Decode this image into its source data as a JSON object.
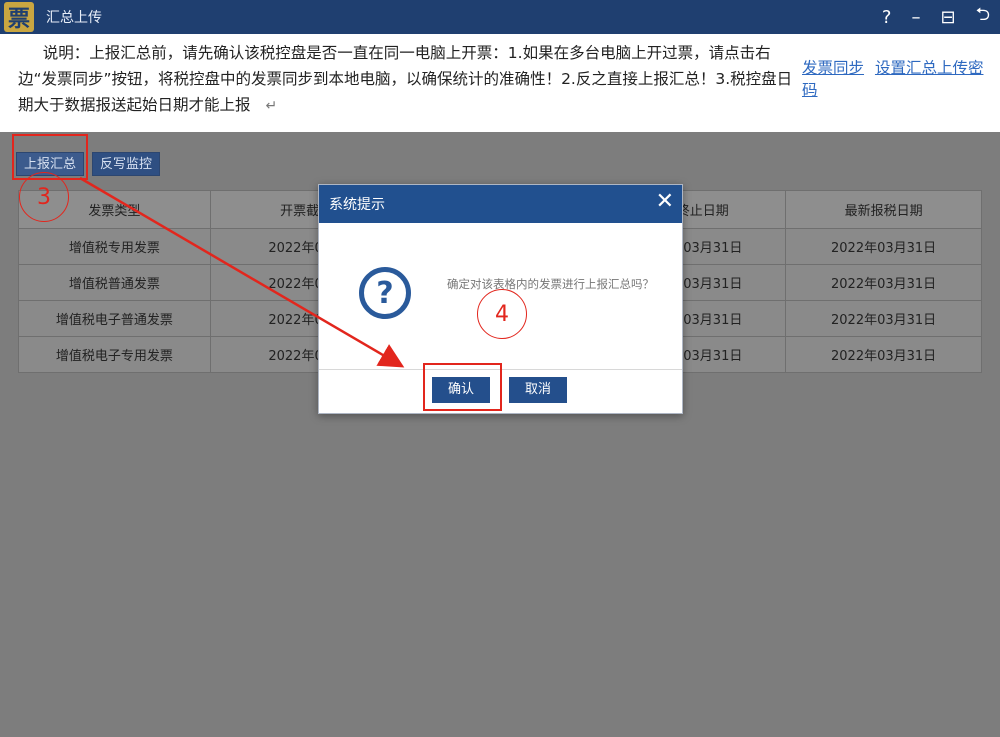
{
  "window": {
    "logo_char": "票",
    "title": "汇总上传",
    "controls": [
      "?",
      "–",
      "⊟",
      "⮌"
    ]
  },
  "description": {
    "text": "说明：上报汇总前，请先确认该税控盘是否一直在同一电脑上开票：1.如果在多台电脑上开过票，请点击右边“发票同步”按钮，将税控盘中的发票同步到本地电脑，以确保统计的准确性！2.反之直接上报汇总！3.税控盘日期大于数据报送起始日期才能上报",
    "return_mark": "↵",
    "links": [
      "发票同步",
      "设置汇总上传密码"
    ]
  },
  "toolbar": {
    "report_button": "上报汇总",
    "monitor_button": "反写监控"
  },
  "table": {
    "headers": [
      "发票类型",
      "开票截止",
      "",
      "报送终止日期",
      "最新报税日期"
    ],
    "rows": [
      [
        "增值税专用发票",
        "2022年04月",
        "",
        "2022年03月31日",
        "2022年03月31日"
      ],
      [
        "增值税普通发票",
        "2022年04月",
        "",
        "2022年03月31日",
        "2022年03月31日"
      ],
      [
        "增值税电子普通发票",
        "2022年04月",
        "",
        "2022年03月31日",
        "2022年03月31日"
      ],
      [
        "增值税电子专用发票",
        "2022年04月",
        "",
        "2022年03月31日",
        "2022年03月31日"
      ]
    ]
  },
  "dialog": {
    "title": "系统提示",
    "close": "✕",
    "icon": "question-icon",
    "message": "确定对该表格内的发票进行上报汇总吗？",
    "ok_label": "确认",
    "cancel_label": "取消"
  },
  "annotations": {
    "step3": "3",
    "step4": "4",
    "color": "#e2261d"
  }
}
